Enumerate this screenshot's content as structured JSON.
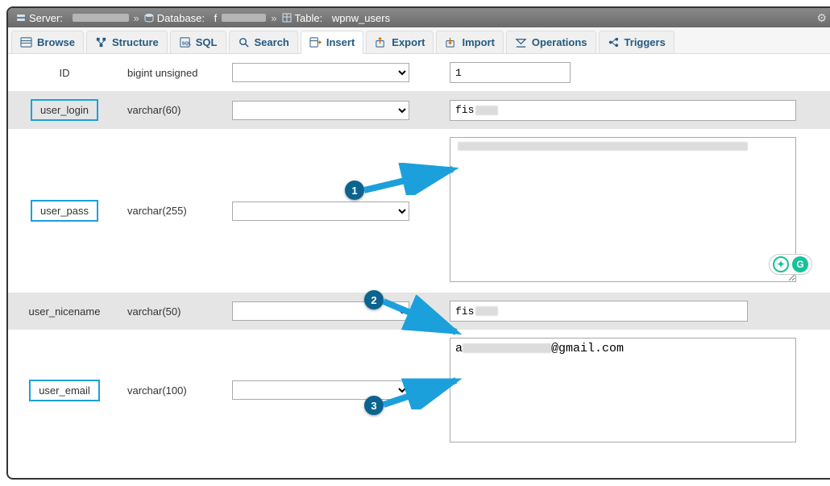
{
  "breadcrumb": {
    "server_label": "Server:",
    "server_value": "",
    "database_label": "Database:",
    "database_value": "f",
    "table_label": "Table:",
    "table_value": "wpnw_users"
  },
  "tabs": [
    {
      "label": "Browse",
      "icon": "browse-icon"
    },
    {
      "label": "Structure",
      "icon": "structure-icon"
    },
    {
      "label": "SQL",
      "icon": "sql-icon"
    },
    {
      "label": "Search",
      "icon": "search-icon"
    },
    {
      "label": "Insert",
      "icon": "insert-icon",
      "active": true
    },
    {
      "label": "Export",
      "icon": "export-icon"
    },
    {
      "label": "Import",
      "icon": "import-icon"
    },
    {
      "label": "Operations",
      "icon": "operations-icon"
    },
    {
      "label": "Triggers",
      "icon": "triggers-icon"
    }
  ],
  "rows": {
    "id": {
      "name": "ID",
      "type": "bigint unsigned",
      "value": "1"
    },
    "user_login": {
      "name": "user_login",
      "type": "varchar(60)",
      "value": "fis"
    },
    "user_pass": {
      "name": "user_pass",
      "type": "varchar(255)",
      "value": ""
    },
    "user_nicename": {
      "name": "user_nicename",
      "type": "varchar(50)",
      "value": "fis"
    },
    "user_email": {
      "name": "user_email",
      "type": "varchar(100)",
      "value_prefix": "a",
      "value_suffix": "@gmail.com"
    }
  },
  "annotations": {
    "b1": "1",
    "b2": "2",
    "b3": "3"
  }
}
